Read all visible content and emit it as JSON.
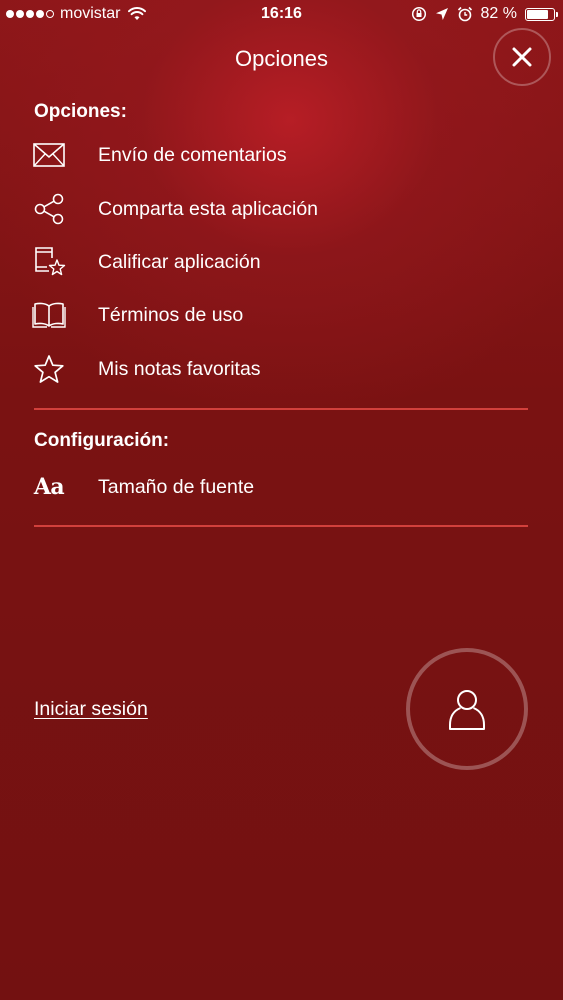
{
  "status_bar": {
    "carrier": "movistar",
    "time": "16:16",
    "battery": "82 %",
    "battery_level": 0.82
  },
  "header": {
    "title": "Opciones"
  },
  "options_section": {
    "heading": "Opciones:",
    "items": [
      {
        "label": "Envío de comentarios",
        "icon": "mail-icon"
      },
      {
        "label": "Comparta esta aplicación",
        "icon": "share-icon"
      },
      {
        "label": "Calificar aplicación",
        "icon": "rate-app-icon"
      },
      {
        "label": "Términos de uso",
        "icon": "book-icon"
      },
      {
        "label": "Mis notas favoritas",
        "icon": "star-icon"
      }
    ]
  },
  "settings_section": {
    "heading": "Configuración:",
    "items": [
      {
        "label": "Tamaño de fuente",
        "icon": "font-size-icon",
        "glyph": "Aa"
      }
    ]
  },
  "account": {
    "login_label": "Iniciar sesión"
  },
  "colors": {
    "background": "#7a1212",
    "highlight": "#b91e26",
    "divider": "#d2403c",
    "text": "#ffffff"
  }
}
